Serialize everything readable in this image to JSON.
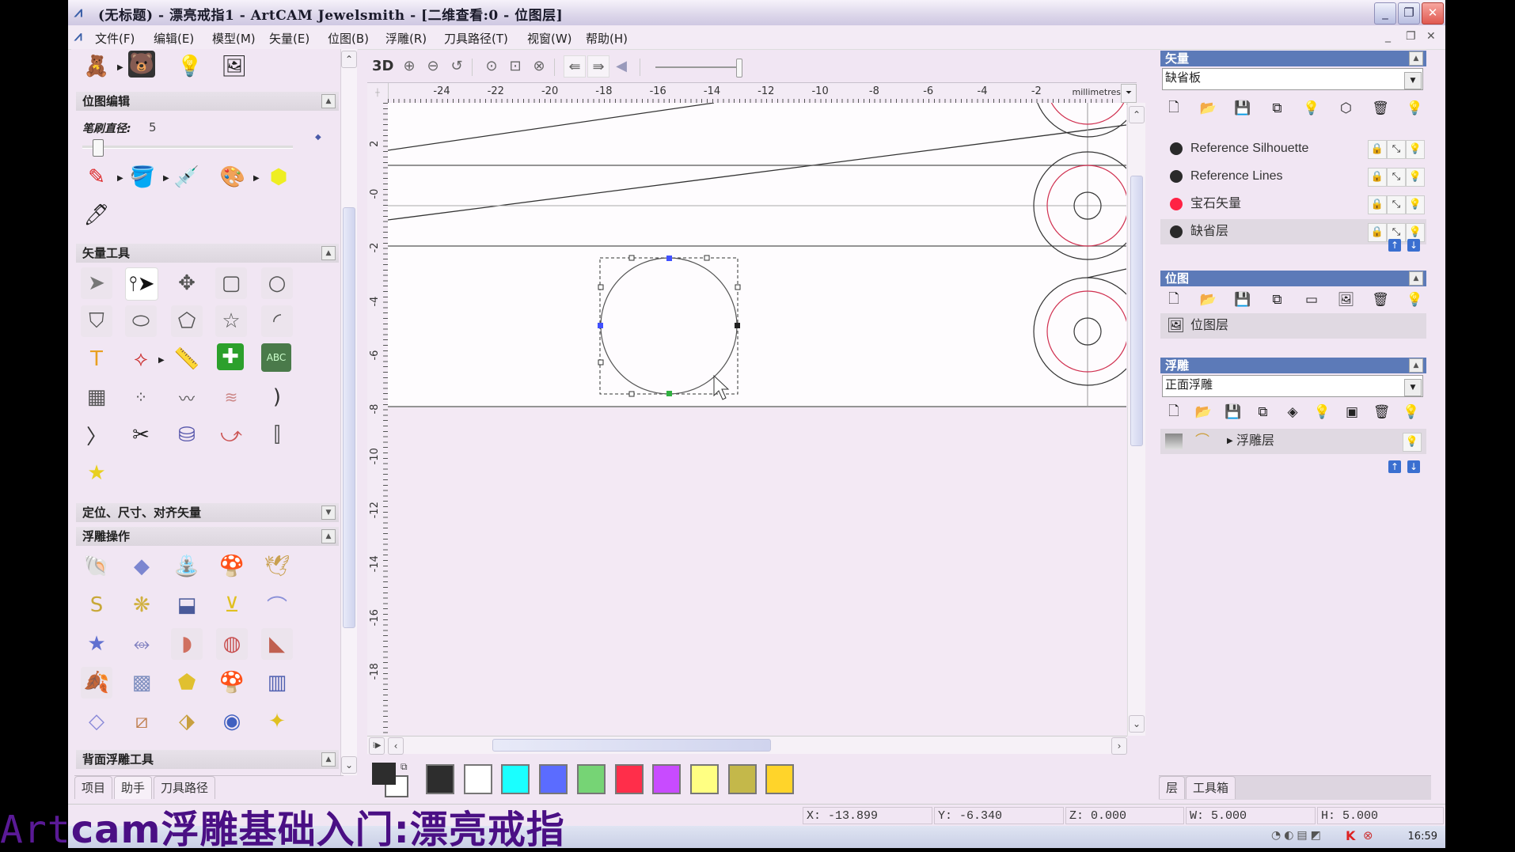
{
  "window": {
    "title": "(无标题) - 漂亮戒指1 - ArtCAM Jewelsmith - [二维查看:0 - 位图层]",
    "controls": {
      "minimize": "_",
      "restore": "❐",
      "close": "✕"
    },
    "mdi_controls": {
      "minimize": "_",
      "restore": "❐",
      "close": "✕"
    }
  },
  "menu": [
    {
      "label": "文件(F)"
    },
    {
      "label": "编辑(E)"
    },
    {
      "label": "模型(M)"
    },
    {
      "label": "矢量(E)"
    },
    {
      "label": "位图(B)"
    },
    {
      "label": "浮雕(R)"
    },
    {
      "label": "刀具路径(T)"
    },
    {
      "label": "视窗(W)"
    },
    {
      "label": "帮助(H)"
    }
  ],
  "left_panel": {
    "top_icons": [
      "teddy-bitmap-icon",
      "grayscale-bitmap-icon",
      "lamp-icon",
      "mona-lisa-icon"
    ],
    "bitmap_edit": {
      "title": "位图编辑",
      "brush_label": "笔刷直径:",
      "brush_value": "5",
      "brush_slider_fraction": 0.05,
      "tools": [
        "pencil-icon",
        "paint-bucket-icon",
        "eyedropper-icon",
        "palette-icon",
        "color-fill-icon",
        "brush-pen-icon"
      ]
    },
    "vector_tools": {
      "title": "矢量工具",
      "tools": [
        "select-arrow-icon",
        "node-edit-icon",
        "transform-icon",
        "rectangle-icon",
        "circle-icon",
        "polyline-icon",
        "ellipse-icon",
        "polygon-icon",
        "star-icon",
        "arc-icon",
        "text-icon",
        "vector-edit-icon",
        "measure-tape-icon",
        "add-icon",
        "text-layout-icon",
        "warp-grid-icon",
        "array-copy-icon",
        "smooth-nodes-icon",
        "offset-icon",
        "vector-doctor-icon",
        "corner-fillet-icon",
        "trim-scissors-icon",
        "wrap-icon",
        "bend-icon",
        "mirror-icon",
        "star-library-icon"
      ]
    },
    "position_section": {
      "title": "定位、尺寸、对齐矢量"
    },
    "relief_ops": {
      "title": "浮雕操作",
      "tools": [
        "shape-editor-icon",
        "plane-icon",
        "extrude-icon",
        "spin-icon",
        "turn-icon",
        "s-curve-icon",
        "celtic-knot-icon",
        "bitmap-to-relief-icon",
        "two-rail-sweep-icon",
        "rotate-relief-icon",
        "star-relief-icon",
        "sweep-icon",
        "smooth-relief-icon",
        "fillet-relief-icon",
        "sculpt-icon",
        "leaf-relief-icon",
        "texture-relief-icon",
        "layer-relief-icon",
        "mushroom-relief-icon",
        "warp-relief-icon",
        "tile-relief-icon",
        "slice-relief-icon",
        "emboss-relief-icon",
        "ball-texture-icon",
        "star-yellow-icon"
      ]
    },
    "back_relief": {
      "title": "背面浮雕工具"
    },
    "tabs": [
      {
        "label": "项目"
      },
      {
        "label": "助手",
        "active": true
      },
      {
        "label": "刀具路径"
      }
    ]
  },
  "view_toolbar": {
    "mode_label": "3D",
    "buttons": [
      "zoom-in-icon",
      "zoom-out-icon",
      "zoom-previous-icon",
      "zoom-1to1-icon",
      "zoom-box-icon",
      "zoom-extents-icon",
      "bitmap-left-icon",
      "bitmap-right-icon",
      "contrast-icon"
    ],
    "slider_fraction": 0.97
  },
  "rulers": {
    "unit": "millimetres",
    "h_ticks": [
      "-24",
      "-22",
      "-20",
      "-18",
      "-16",
      "-14",
      "-12",
      "-10",
      "-8",
      "-6",
      "-4",
      "-2"
    ],
    "v_ticks": [
      "2",
      "-0",
      "-2",
      "-4",
      "-6",
      "-8",
      "-10",
      "-12",
      "-14",
      "-16",
      "-18"
    ]
  },
  "canvas": {
    "selection_box": "circle 5 × 5",
    "cursor": "arrow"
  },
  "palette": {
    "foreground": "#2d2d2d",
    "background": "#ffffff",
    "colors": [
      "#2d2d2d",
      "#ffffff",
      "#1affff",
      "#5b6cff",
      "#76d475",
      "#ff2e4a",
      "#c84bff",
      "#ffff82",
      "#c4b84a",
      "#ffd42a"
    ]
  },
  "right_panel": {
    "vectors": {
      "title": "矢量",
      "sheet": "缺省板",
      "toolbar": [
        "new-layer-icon",
        "open-folder-icon",
        "save-icon",
        "merge-icon",
        "bulb-icon",
        "shapes-icon",
        "trash-icon",
        "all-bulbs-icon"
      ],
      "layers": [
        {
          "name": "Reference Silhouette",
          "color": "#2a2a2a"
        },
        {
          "name": "Reference Lines",
          "color": "#2a2a2a"
        },
        {
          "name": "宝石矢量",
          "color": "#ff2244"
        },
        {
          "name": "缺省层",
          "color": "#2a2a2a",
          "active": true
        }
      ]
    },
    "bitmaps": {
      "title": "位图",
      "toolbar": [
        "new-layer-icon",
        "open-folder-icon",
        "save-icon",
        "merge-icon",
        "gray-icon",
        "mona-icon",
        "trash-icon",
        "all-bulbs-icon"
      ],
      "layers": [
        {
          "name": "位图层"
        }
      ]
    },
    "reliefs": {
      "title": "浮雕",
      "relief": "正面浮雕",
      "toolbar": [
        "new-layer-icon",
        "open-folder-icon",
        "save-icon",
        "merge-icon",
        "layers-icon",
        "bulb-icon",
        "bitmap-icon",
        "trash-icon",
        "all-bulbs-icon"
      ],
      "layers": [
        {
          "name": "浮雕层"
        }
      ]
    },
    "tabs": [
      {
        "label": "层",
        "active": true
      },
      {
        "label": "工具箱"
      }
    ]
  },
  "status": {
    "x": "X: -13.899",
    "y": "Y: -6.340",
    "z": "Z: 0.000",
    "w": "W: 5.000",
    "h": "H: 5.000"
  },
  "taskbar": {
    "clock": "16:59"
  },
  "subtitle": {
    "prefix": "Art",
    "text": "cam浮雕基础入门:漂亮戒指"
  }
}
